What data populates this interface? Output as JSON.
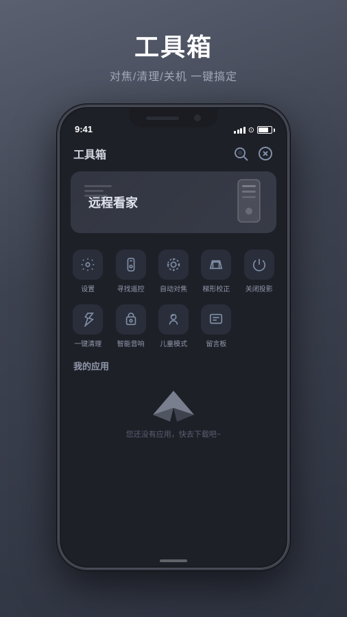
{
  "page": {
    "title": "工具箱",
    "subtitle": "对焦/清理/关机  一键搞定"
  },
  "status_bar": {
    "time": "9:41",
    "battery_label": "battery"
  },
  "app": {
    "header_title": "工具箱",
    "search_icon": "search",
    "settings_icon": "settings"
  },
  "banner": {
    "text": "远程看家",
    "line_widths": [
      40,
      28,
      34
    ]
  },
  "grid_row1": [
    {
      "label": "设置",
      "icon": "⚙️"
    },
    {
      "label": "寻找遥控",
      "icon": "🔍"
    },
    {
      "label": "自动对焦",
      "icon": "🌀"
    },
    {
      "label": "梯形校正",
      "icon": "🐱"
    },
    {
      "label": "关闭投影",
      "icon": "⏻"
    }
  ],
  "grid_row2": [
    {
      "label": "一键清理",
      "icon": "🚀"
    },
    {
      "label": "智能音响",
      "icon": "📺"
    },
    {
      "label": "儿童模式",
      "icon": "🐱"
    },
    {
      "label": "留言板",
      "icon": "📋"
    }
  ],
  "section": {
    "my_apps_title": "我的应用",
    "no_apps_text": "您还没有应用，快去下载吧~"
  }
}
